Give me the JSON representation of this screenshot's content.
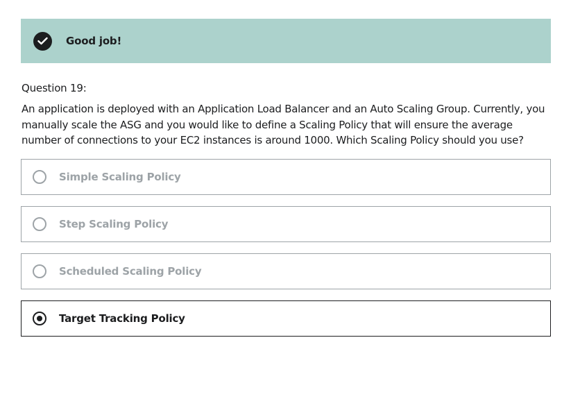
{
  "banner": {
    "message": "Good job!",
    "icon": "check-circle-icon",
    "background_color": "#acd2cc"
  },
  "question": {
    "label": "Question 19:",
    "text": "An application is deployed with an Application Load Balancer and an Auto Scaling Group. Currently, you manually scale the ASG and you would like to define a Scaling Policy that will ensure the average number of connections to your EC2 instances is around 1000. Which Scaling Policy should you use?"
  },
  "options": [
    {
      "label": "Simple Scaling Policy",
      "selected": false
    },
    {
      "label": "Step Scaling Policy",
      "selected": false
    },
    {
      "label": "Scheduled Scaling Policy",
      "selected": false
    },
    {
      "label": "Target Tracking Policy",
      "selected": true
    }
  ],
  "colors": {
    "text": "#1c1d1f",
    "muted": "#9da3a7"
  }
}
